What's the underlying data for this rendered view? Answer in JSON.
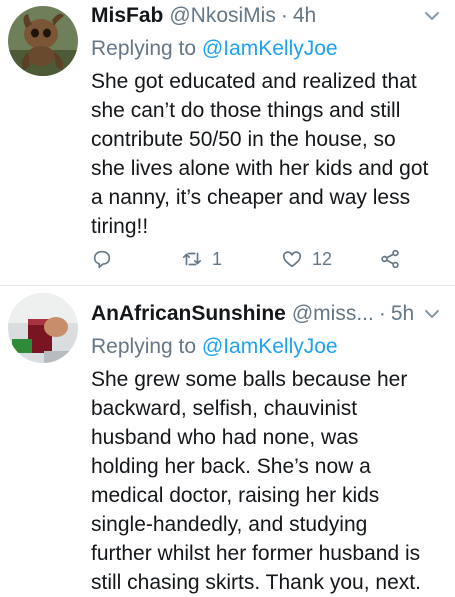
{
  "tweets": [
    {
      "name": "MisFab",
      "handle": "@NkosiMis",
      "separator": "·",
      "time": "4h",
      "replying_prefix": "Replying to",
      "replying_to": "@IamKellyJoe",
      "lines": [
        "She got educated and realized that",
        "she can’t do those things and still",
        "contribute 50/50 in the house, so",
        "she lives alone with her kids and got",
        "a nanny, it’s cheaper and way less",
        "tiring!!"
      ],
      "retweet_count": "1",
      "like_count": "12"
    },
    {
      "name": "AnAfricanSunshine",
      "handle": "@miss...",
      "separator": "·",
      "time": "5h",
      "replying_prefix": "Replying to",
      "replying_to": "@IamKellyJoe",
      "lines": [
        "She grew some balls because her",
        "backward, selfish, chauvinist",
        "husband who had none, was",
        "holding her back. She’s now a",
        "medical doctor, raising her kids",
        "single-handedly, and studying",
        "further whilst her former husband is",
        "still chasing skirts. Thank you, next."
      ]
    }
  ],
  "icons": {
    "reply": "reply-icon",
    "retweet": "retweet-icon",
    "like": "heart-icon",
    "share": "share-icon",
    "caret": "chevron-down-icon"
  },
  "colors": {
    "link": "#1da1f2",
    "secondary": "#657786",
    "text": "#14171a",
    "divider": "#e1e8ed"
  }
}
